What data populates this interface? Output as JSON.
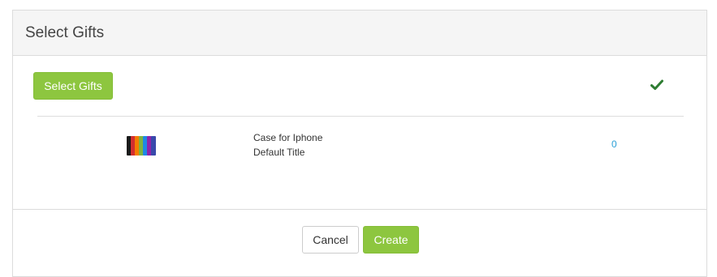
{
  "header": {
    "title": "Select Gifts"
  },
  "body": {
    "select_button_label": "Select Gifts",
    "status_icon": "checkmark-icon",
    "status_color": "#2e7d32",
    "products": [
      {
        "thumbnail_icon": "phone-cases-thumbnail",
        "name": "Case for Iphone",
        "variant": "Default Title",
        "quantity": "0"
      }
    ]
  },
  "footer": {
    "cancel_label": "Cancel",
    "create_label": "Create"
  },
  "colors": {
    "accent": "#8dc63f",
    "link": "#2a9fd6"
  }
}
